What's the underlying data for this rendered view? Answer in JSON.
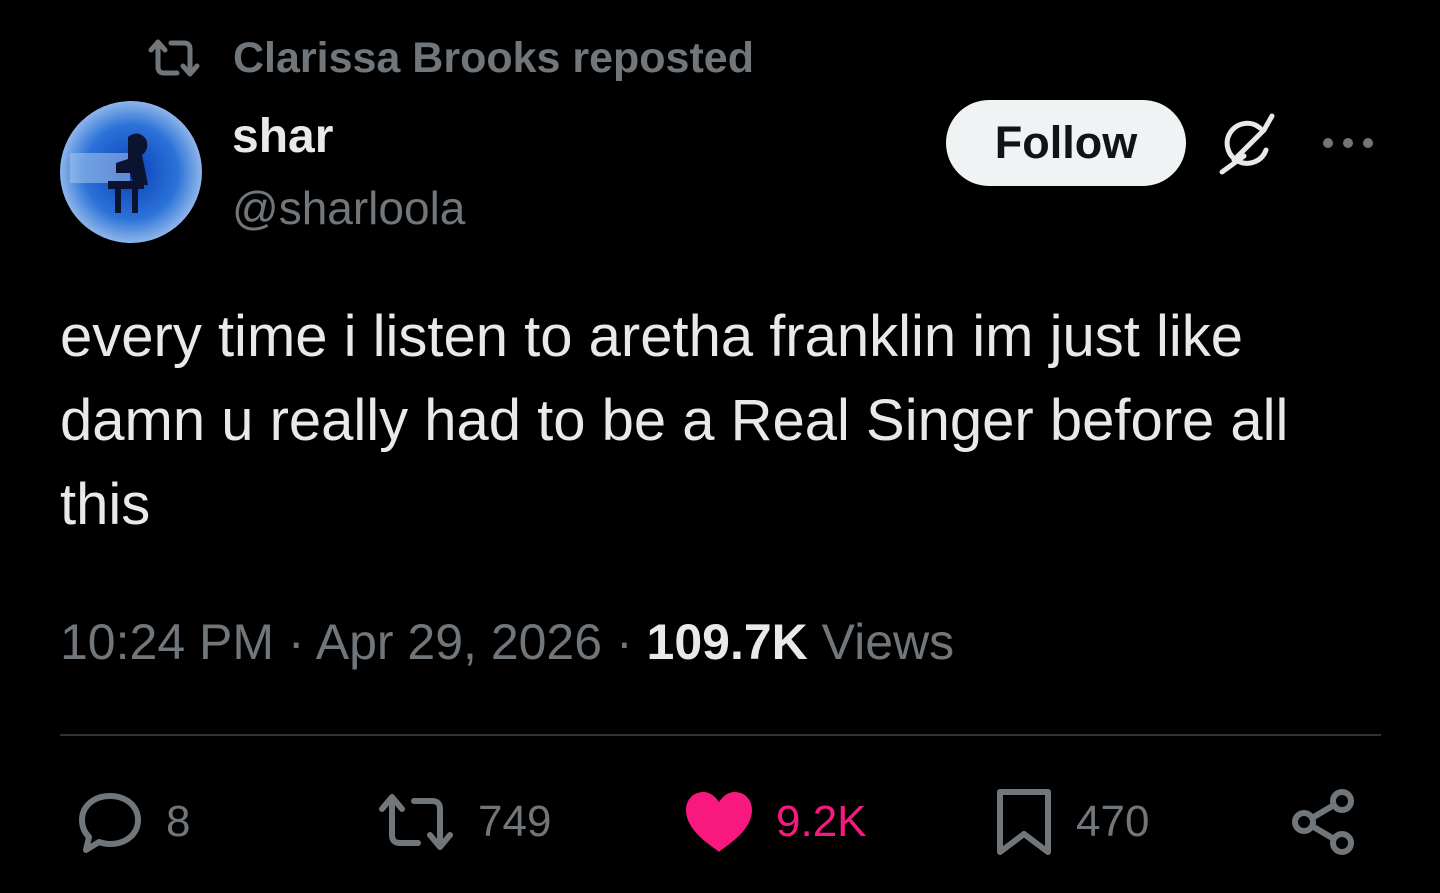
{
  "repost_banner": {
    "text": "Clarissa Brooks reposted",
    "icon": "repost-icon"
  },
  "author": {
    "display_name": "shar",
    "handle": "@sharloola",
    "avatar_icon": "avatar"
  },
  "header_actions": {
    "follow_label": "Follow",
    "grok_icon": "grok-icon",
    "more_icon": "more-icon"
  },
  "tweet": {
    "text": "every time i listen to aretha franklin im just like damn u really had to be a Real Singer before all this"
  },
  "meta": {
    "time": "10:24 PM",
    "separator": "·",
    "date": "Apr 29, 2026",
    "views_count": "109.7K",
    "views_label": "Views"
  },
  "actions": {
    "replies": "8",
    "reposts": "749",
    "likes": "9.2K",
    "bookmarks": "470"
  },
  "colors": {
    "background": "#000000",
    "text_primary": "#e7e9ea",
    "text_secondary": "#71767b",
    "like_active": "#f91880",
    "divider": "#2f3336",
    "follow_bg": "#eff3f4"
  }
}
